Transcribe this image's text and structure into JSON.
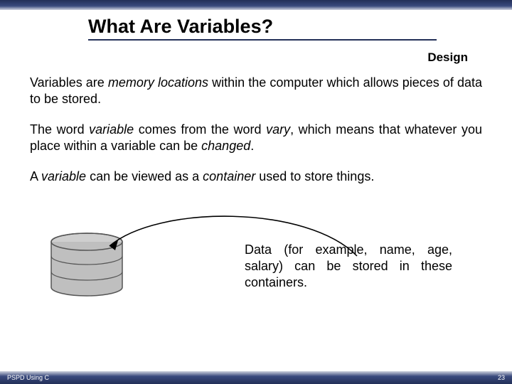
{
  "header": {
    "title": "What Are Variables?",
    "sub": "Design"
  },
  "body": {
    "p1a": "Variables are ",
    "p1b": "memory locations",
    "p1c": " within the computer which allows pieces of data to be stored.",
    "p2a": "The word ",
    "p2b": "variable",
    "p2c": " comes from the word ",
    "p2d": "vary",
    "p2e": ", which means that whatever you place within a variable can be ",
    "p2f": "changed",
    "p2g": ".",
    "p3a": "A ",
    "p3b": "variable",
    "p3c": " can be viewed as a ",
    "p3d": "container",
    "p3e": " used to store things.",
    "caption": "Data (for example, name, age, salary) can be stored in these containers."
  },
  "footer": {
    "left": "PSPD Using C",
    "right": "23"
  }
}
